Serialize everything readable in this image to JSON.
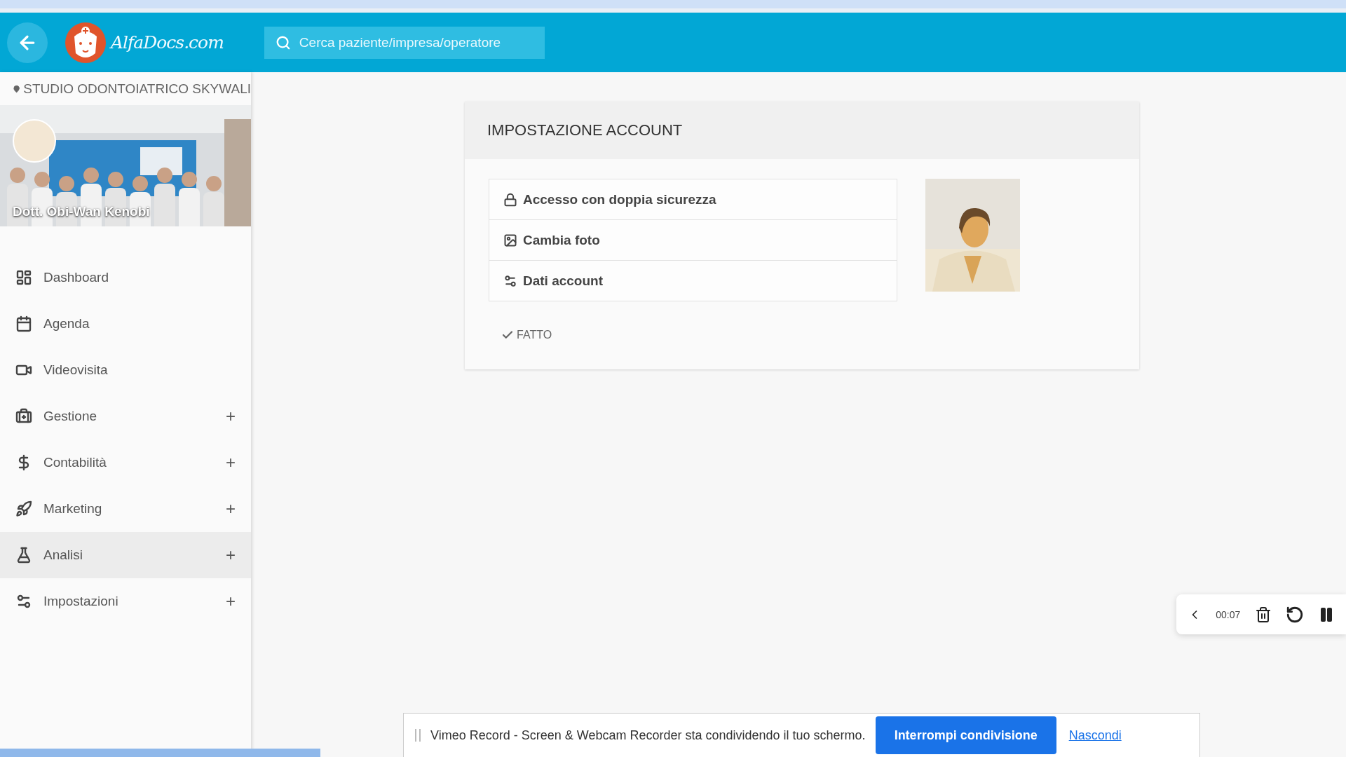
{
  "topbar": {
    "logo_text": "AlfaDocs.com",
    "search": {
      "placeholder": "Cerca paziente/impresa/operatore"
    }
  },
  "sidebar": {
    "location": "STUDIO ODONTOIATRICO SKYWALI",
    "profile": {
      "name": "Dott. Obi-Wan Kenobi"
    },
    "items": [
      {
        "label": "Dashboard",
        "selected": false
      },
      {
        "label": "Agenda",
        "selected": false
      },
      {
        "label": "Videovisita",
        "selected": false
      },
      {
        "label": "Gestione",
        "expand_symbol": "+",
        "selected": false
      },
      {
        "label": "Contabilità",
        "expand_symbol": "+",
        "selected": false
      },
      {
        "label": "Marketing",
        "expand_symbol": "+",
        "selected": false
      },
      {
        "label": "Analisi",
        "expand_symbol": "+",
        "selected": true
      },
      {
        "label": "Impostazioni",
        "expand_symbol": "+",
        "selected": false
      }
    ]
  },
  "card": {
    "title": "IMPOSTAZIONE ACCOUNT",
    "options": [
      {
        "label": "Accesso con doppia sicurezza"
      },
      {
        "label": "Cambia foto"
      },
      {
        "label": "Dati account"
      }
    ],
    "done_button": "FATTO"
  },
  "recorder": {
    "time": "00:07"
  },
  "share_bar": {
    "message": "Vimeo Record - Screen & Webcam Recorder sta condividendo il tuo schermo.",
    "stop_button": "Interrompi condivisione",
    "hide_link": "Nascondi"
  }
}
